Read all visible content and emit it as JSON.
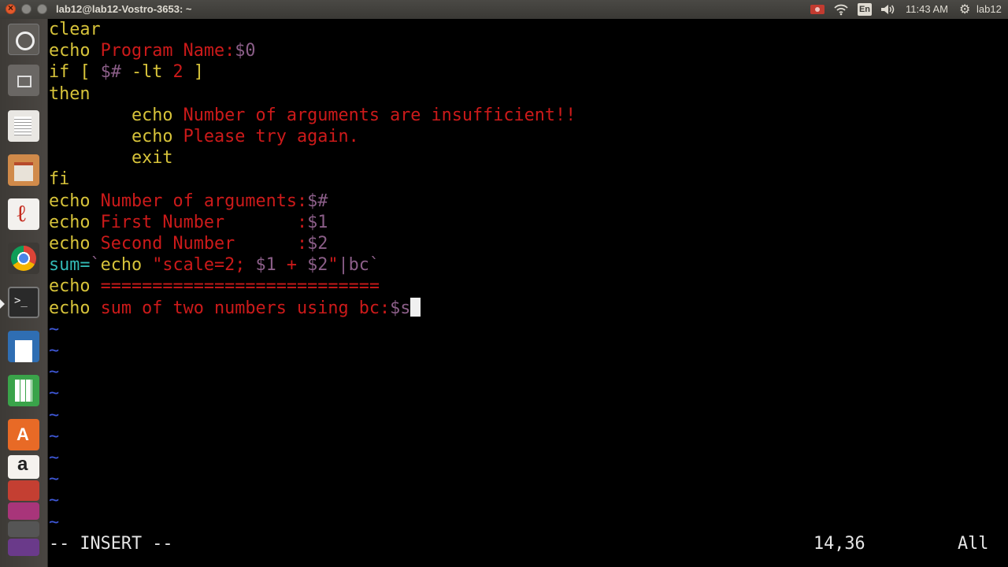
{
  "window": {
    "title": "lab12@lab12-Vostro-3653: ~"
  },
  "tray": {
    "lang": "En",
    "time": "11:43 AM",
    "user": "lab12"
  },
  "launcher": {
    "items": [
      "ubuntu-dash",
      "files",
      "text-editor",
      "file-cabinet",
      "pdf-viewer",
      "chrome",
      "terminal",
      "writer",
      "calc",
      "software-center",
      "amazon",
      "misc-a",
      "misc-b",
      "misc-c",
      "misc-d"
    ]
  },
  "editor": {
    "lines": [
      [
        {
          "t": "clear",
          "c": "y"
        }
      ],
      [
        {
          "t": "echo ",
          "c": "y"
        },
        {
          "t": "Program Name:",
          "c": "r"
        },
        {
          "t": "$0",
          "c": "p"
        }
      ],
      [
        {
          "t": "if [ ",
          "c": "y"
        },
        {
          "t": "$#",
          "c": "p"
        },
        {
          "t": " -lt ",
          "c": "y"
        },
        {
          "t": "2",
          "c": "r"
        },
        {
          "t": " ]",
          "c": "y"
        }
      ],
      [
        {
          "t": "then",
          "c": "y"
        }
      ],
      [
        {
          "t": "        echo ",
          "c": "y"
        },
        {
          "t": "Number of arguments are insufficient!!",
          "c": "r"
        }
      ],
      [
        {
          "t": "        echo ",
          "c": "y"
        },
        {
          "t": "Please try again.",
          "c": "r"
        }
      ],
      [
        {
          "t": "        exit",
          "c": "y"
        }
      ],
      [
        {
          "t": "fi",
          "c": "y"
        }
      ],
      [
        {
          "t": "echo ",
          "c": "y"
        },
        {
          "t": "Number of arguments:",
          "c": "r"
        },
        {
          "t": "$#",
          "c": "p"
        }
      ],
      [
        {
          "t": "echo ",
          "c": "y"
        },
        {
          "t": "First Number       :",
          "c": "r"
        },
        {
          "t": "$1",
          "c": "p"
        }
      ],
      [
        {
          "t": "echo ",
          "c": "y"
        },
        {
          "t": "Second Number      :",
          "c": "r"
        },
        {
          "t": "$2",
          "c": "p"
        }
      ],
      [
        {
          "t": "sum=",
          "c": "c"
        },
        {
          "t": "`",
          "c": "p"
        },
        {
          "t": "echo ",
          "c": "y"
        },
        {
          "t": "\"scale=2; ",
          "c": "r"
        },
        {
          "t": "$1",
          "c": "p"
        },
        {
          "t": " + ",
          "c": "r"
        },
        {
          "t": "$2",
          "c": "p"
        },
        {
          "t": "\"",
          "c": "r"
        },
        {
          "t": "|bc",
          "c": "p"
        },
        {
          "t": "`",
          "c": "p"
        }
      ],
      [
        {
          "t": "echo ",
          "c": "y"
        },
        {
          "t": "===========================",
          "c": "r"
        }
      ],
      [
        {
          "t": "echo ",
          "c": "y"
        },
        {
          "t": "sum of two numbers using bc:",
          "c": "r"
        },
        {
          "t": "$s",
          "c": "p"
        }
      ]
    ],
    "tilde": "~",
    "mode": "-- INSERT --",
    "position": "14,36",
    "scroll": "All"
  }
}
